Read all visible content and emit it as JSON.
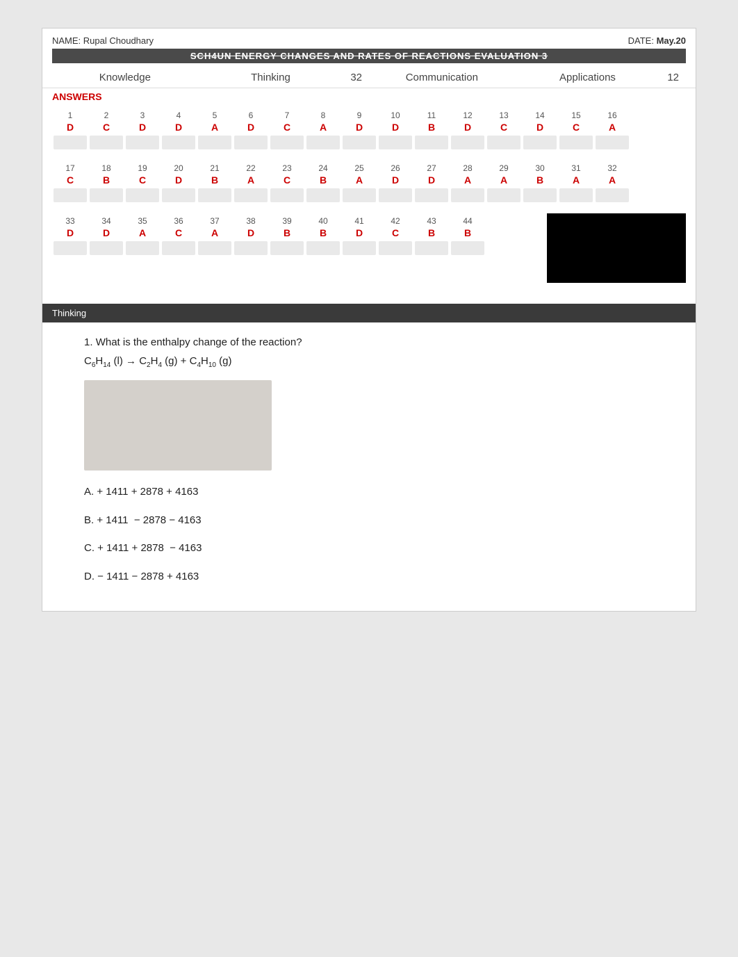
{
  "header": {
    "name_label": "NAME:",
    "name_value": "Rupal Choudhary",
    "date_label": "DATE:",
    "date_value": "May.20",
    "title": "SCH4UN          ENERGY CHANGES AND RATES OF REACTIONS          EVALUATION 3"
  },
  "categories": {
    "knowledge": "Knowledge",
    "thinking": "Thinking",
    "thinking_score": "32",
    "communication": "Communication",
    "applications": "Applications",
    "applications_score": "12"
  },
  "answers_label": "ANSWERS",
  "rows": [
    {
      "numbers": [
        "1",
        "2",
        "3",
        "4",
        "5",
        "6",
        "7",
        "8",
        "9",
        "10",
        "11",
        "12",
        "13",
        "14",
        "15",
        "16"
      ],
      "answers": [
        "D",
        "C",
        "D",
        "D",
        "A",
        "D",
        "C",
        "A",
        "D",
        "D",
        "B",
        "D",
        "C",
        "D",
        "C",
        "A"
      ]
    },
    {
      "numbers": [
        "17",
        "18",
        "19",
        "20",
        "21",
        "22",
        "23",
        "24",
        "25",
        "26",
        "27",
        "28",
        "29",
        "30",
        "31",
        "32"
      ],
      "answers": [
        "C",
        "B",
        "C",
        "D",
        "B",
        "A",
        "C",
        "B",
        "A",
        "D",
        "D",
        "A",
        "A",
        "B",
        "A",
        "A"
      ]
    },
    {
      "numbers": [
        "33",
        "34",
        "35",
        "36",
        "37",
        "38",
        "39",
        "40",
        "41",
        "42",
        "43",
        "44"
      ],
      "answers": [
        "D",
        "D",
        "A",
        "C",
        "A",
        "D",
        "B",
        "B",
        "D",
        "C",
        "B",
        "B"
      ]
    }
  ],
  "section_bar": "Thinking",
  "question1": {
    "number": "1.",
    "text": "What is the enthalpy change of the reaction?",
    "equation": "C₆H₁₄ (l) → C₂H₄ (g) + C₄H₁₀ (g)",
    "choices": [
      {
        "label": "A.",
        "text": "+ 1411 + 2878 + 4163"
      },
      {
        "label": "B.",
        "text": "+ 1411  − 2878 − 4163"
      },
      {
        "label": "C.",
        "text": "+ 1411 + 2878  − 4163"
      },
      {
        "label": "D.",
        "text": "− 1411 − 2878 + 4163"
      }
    ]
  }
}
